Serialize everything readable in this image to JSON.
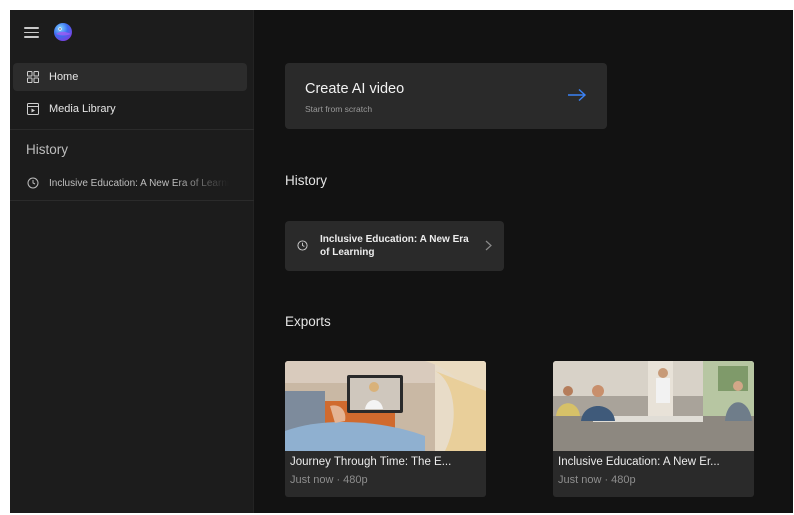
{
  "sidebar": {
    "nav": [
      {
        "label": "Home",
        "icon": "grid-icon",
        "active": true
      },
      {
        "label": "Media Library",
        "icon": "media-library-icon",
        "active": false
      }
    ],
    "history_title": "History",
    "history_items": [
      {
        "label": "Inclusive Education: A New Era of Learning",
        "icon": "clock-icon"
      }
    ]
  },
  "main": {
    "create": {
      "title": "Create AI video",
      "subtitle": "Start from scratch",
      "icon": "arrow-right-icon"
    },
    "history_title": "History",
    "history_items": [
      {
        "label": "Inclusive Education: A New Era of Learning"
      }
    ],
    "exports_title": "Exports",
    "exports": [
      {
        "title": "Journey Through Time: The E...",
        "meta": "Just now · 480p"
      },
      {
        "title": "Inclusive Education: A New Er...",
        "meta": "Just now · 480p"
      }
    ]
  },
  "colors": {
    "background": "#121212",
    "sidebar": "#1c1c1c",
    "card": "#2a2a2a",
    "accent": "#3b82f6"
  }
}
